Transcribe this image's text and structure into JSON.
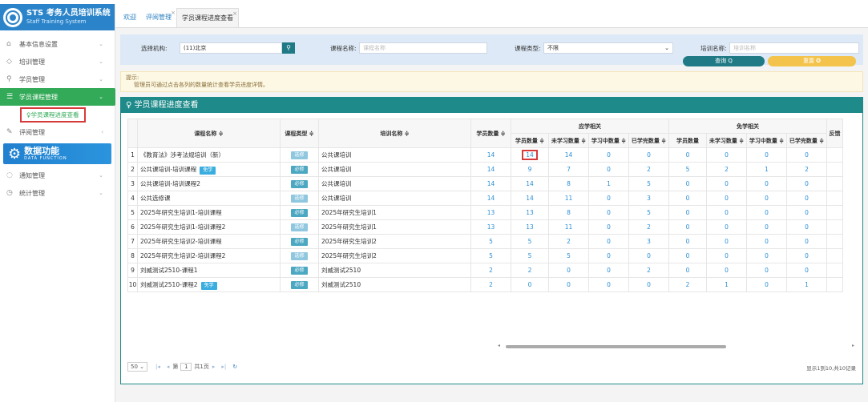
{
  "sidebar": {
    "brand_title": "STS 考务人员培训系统",
    "brand_sub": "Staff Training System",
    "items": [
      {
        "label": "基本信息设置",
        "icon": "home-icon"
      },
      {
        "label": "培训管理",
        "icon": "graduation-cap-icon"
      },
      {
        "label": "学员管理",
        "icon": "user-icon"
      },
      {
        "label": "学员课程管理",
        "icon": "list-icon"
      },
      {
        "label": "评阅管理",
        "icon": "edit-icon"
      },
      {
        "label": "通知管理",
        "icon": "chat-icon"
      },
      {
        "label": "统计管理",
        "icon": "clock-icon"
      }
    ],
    "sub_item": "学员课程进度查看",
    "data_banner_title": "数据功能",
    "data_banner_sub": "DATA FUNCTION"
  },
  "tabs": [
    {
      "label": "欢迎"
    },
    {
      "label": "评阅管理"
    },
    {
      "label": "学员课程进度查看"
    }
  ],
  "filter": {
    "org_label": "选择机构:",
    "org_value": "(11)北京",
    "course_label": "课程名称:",
    "course_placeholder": "课程名称",
    "type_label": "课程类型:",
    "type_value": "不限",
    "training_label": "培训名称:",
    "training_placeholder": "培训名称",
    "query_label": "查询 Q",
    "reset_label": "重置 ✪"
  },
  "tip": {
    "title": "提示:",
    "body": "管理员可通过点击各列的数量统计查看学员进度详情。"
  },
  "panel": {
    "title": "学员课程进度查看"
  },
  "table": {
    "h_course": "课程名称 ≑",
    "h_type": "课程类型 ≑",
    "h_training": "培训名称 ≑",
    "h_students": "学员数量 ≑",
    "h_group_required": "应学相关",
    "h_group_exempt": "免学相关",
    "h_feedback": "反馈",
    "sub_headers": [
      "学员数量 ≑",
      "未学习数量 ≑",
      "学习中数量 ≑",
      "已学完数量 ≑",
      "学员数量",
      "未学习数量 ≑",
      "学习中数量 ≑",
      "已学完数量 ≑"
    ],
    "rows": [
      {
        "no": "1",
        "course": "《教育法》涉考法规培训（新）",
        "tag": "",
        "type": "选修",
        "training": "公共课培训",
        "students": "14",
        "v": [
          "14",
          "14",
          "0",
          "0",
          "0",
          "0",
          "0",
          "0"
        ]
      },
      {
        "no": "2",
        "course": "公共课培训-培训课程",
        "tag": "免学",
        "type": "必修",
        "training": "公共课培训",
        "students": "14",
        "v": [
          "9",
          "7",
          "0",
          "2",
          "5",
          "2",
          "1",
          "2"
        ]
      },
      {
        "no": "3",
        "course": "公共课培训-培训课程2",
        "tag": "",
        "type": "必修",
        "training": "公共课培训",
        "students": "14",
        "v": [
          "14",
          "8",
          "1",
          "5",
          "0",
          "0",
          "0",
          "0"
        ]
      },
      {
        "no": "4",
        "course": "公共选修课",
        "tag": "",
        "type": "选修",
        "training": "公共课培训",
        "students": "14",
        "v": [
          "14",
          "11",
          "0",
          "3",
          "0",
          "0",
          "0",
          "0"
        ]
      },
      {
        "no": "5",
        "course": "2025年研究生培训1-培训课程",
        "tag": "",
        "type": "必修",
        "training": "2025年研究生培训1",
        "students": "13",
        "v": [
          "13",
          "8",
          "0",
          "5",
          "0",
          "0",
          "0",
          "0"
        ]
      },
      {
        "no": "6",
        "course": "2025年研究生培训1-培训课程2",
        "tag": "",
        "type": "选修",
        "training": "2025年研究生培训1",
        "students": "13",
        "v": [
          "13",
          "11",
          "0",
          "2",
          "0",
          "0",
          "0",
          "0"
        ]
      },
      {
        "no": "7",
        "course": "2025年研究生培训2-培训课程",
        "tag": "",
        "type": "必修",
        "training": "2025年研究生培训2",
        "students": "5",
        "v": [
          "5",
          "2",
          "0",
          "3",
          "0",
          "0",
          "0",
          "0"
        ]
      },
      {
        "no": "8",
        "course": "2025年研究生培训2-培训课程2",
        "tag": "",
        "type": "选修",
        "training": "2025年研究生培训2",
        "students": "5",
        "v": [
          "5",
          "5",
          "0",
          "0",
          "0",
          "0",
          "0",
          "0"
        ]
      },
      {
        "no": "9",
        "course": "刘威测试2510-课程1",
        "tag": "",
        "type": "必修",
        "training": "刘威测试2510",
        "students": "2",
        "v": [
          "2",
          "0",
          "0",
          "2",
          "0",
          "0",
          "0",
          "0"
        ]
      },
      {
        "no": "10",
        "course": "刘威测试2510-课程2",
        "tag": "免学",
        "type": "必修",
        "training": "刘威测试2510",
        "students": "2",
        "v": [
          "0",
          "0",
          "0",
          "0",
          "2",
          "1",
          "0",
          "1"
        ]
      }
    ]
  },
  "pager": {
    "page_size": "50",
    "page_prefix": "第",
    "page_value": "1",
    "page_total": "共1页",
    "records": "显示1到10,共10记录"
  }
}
